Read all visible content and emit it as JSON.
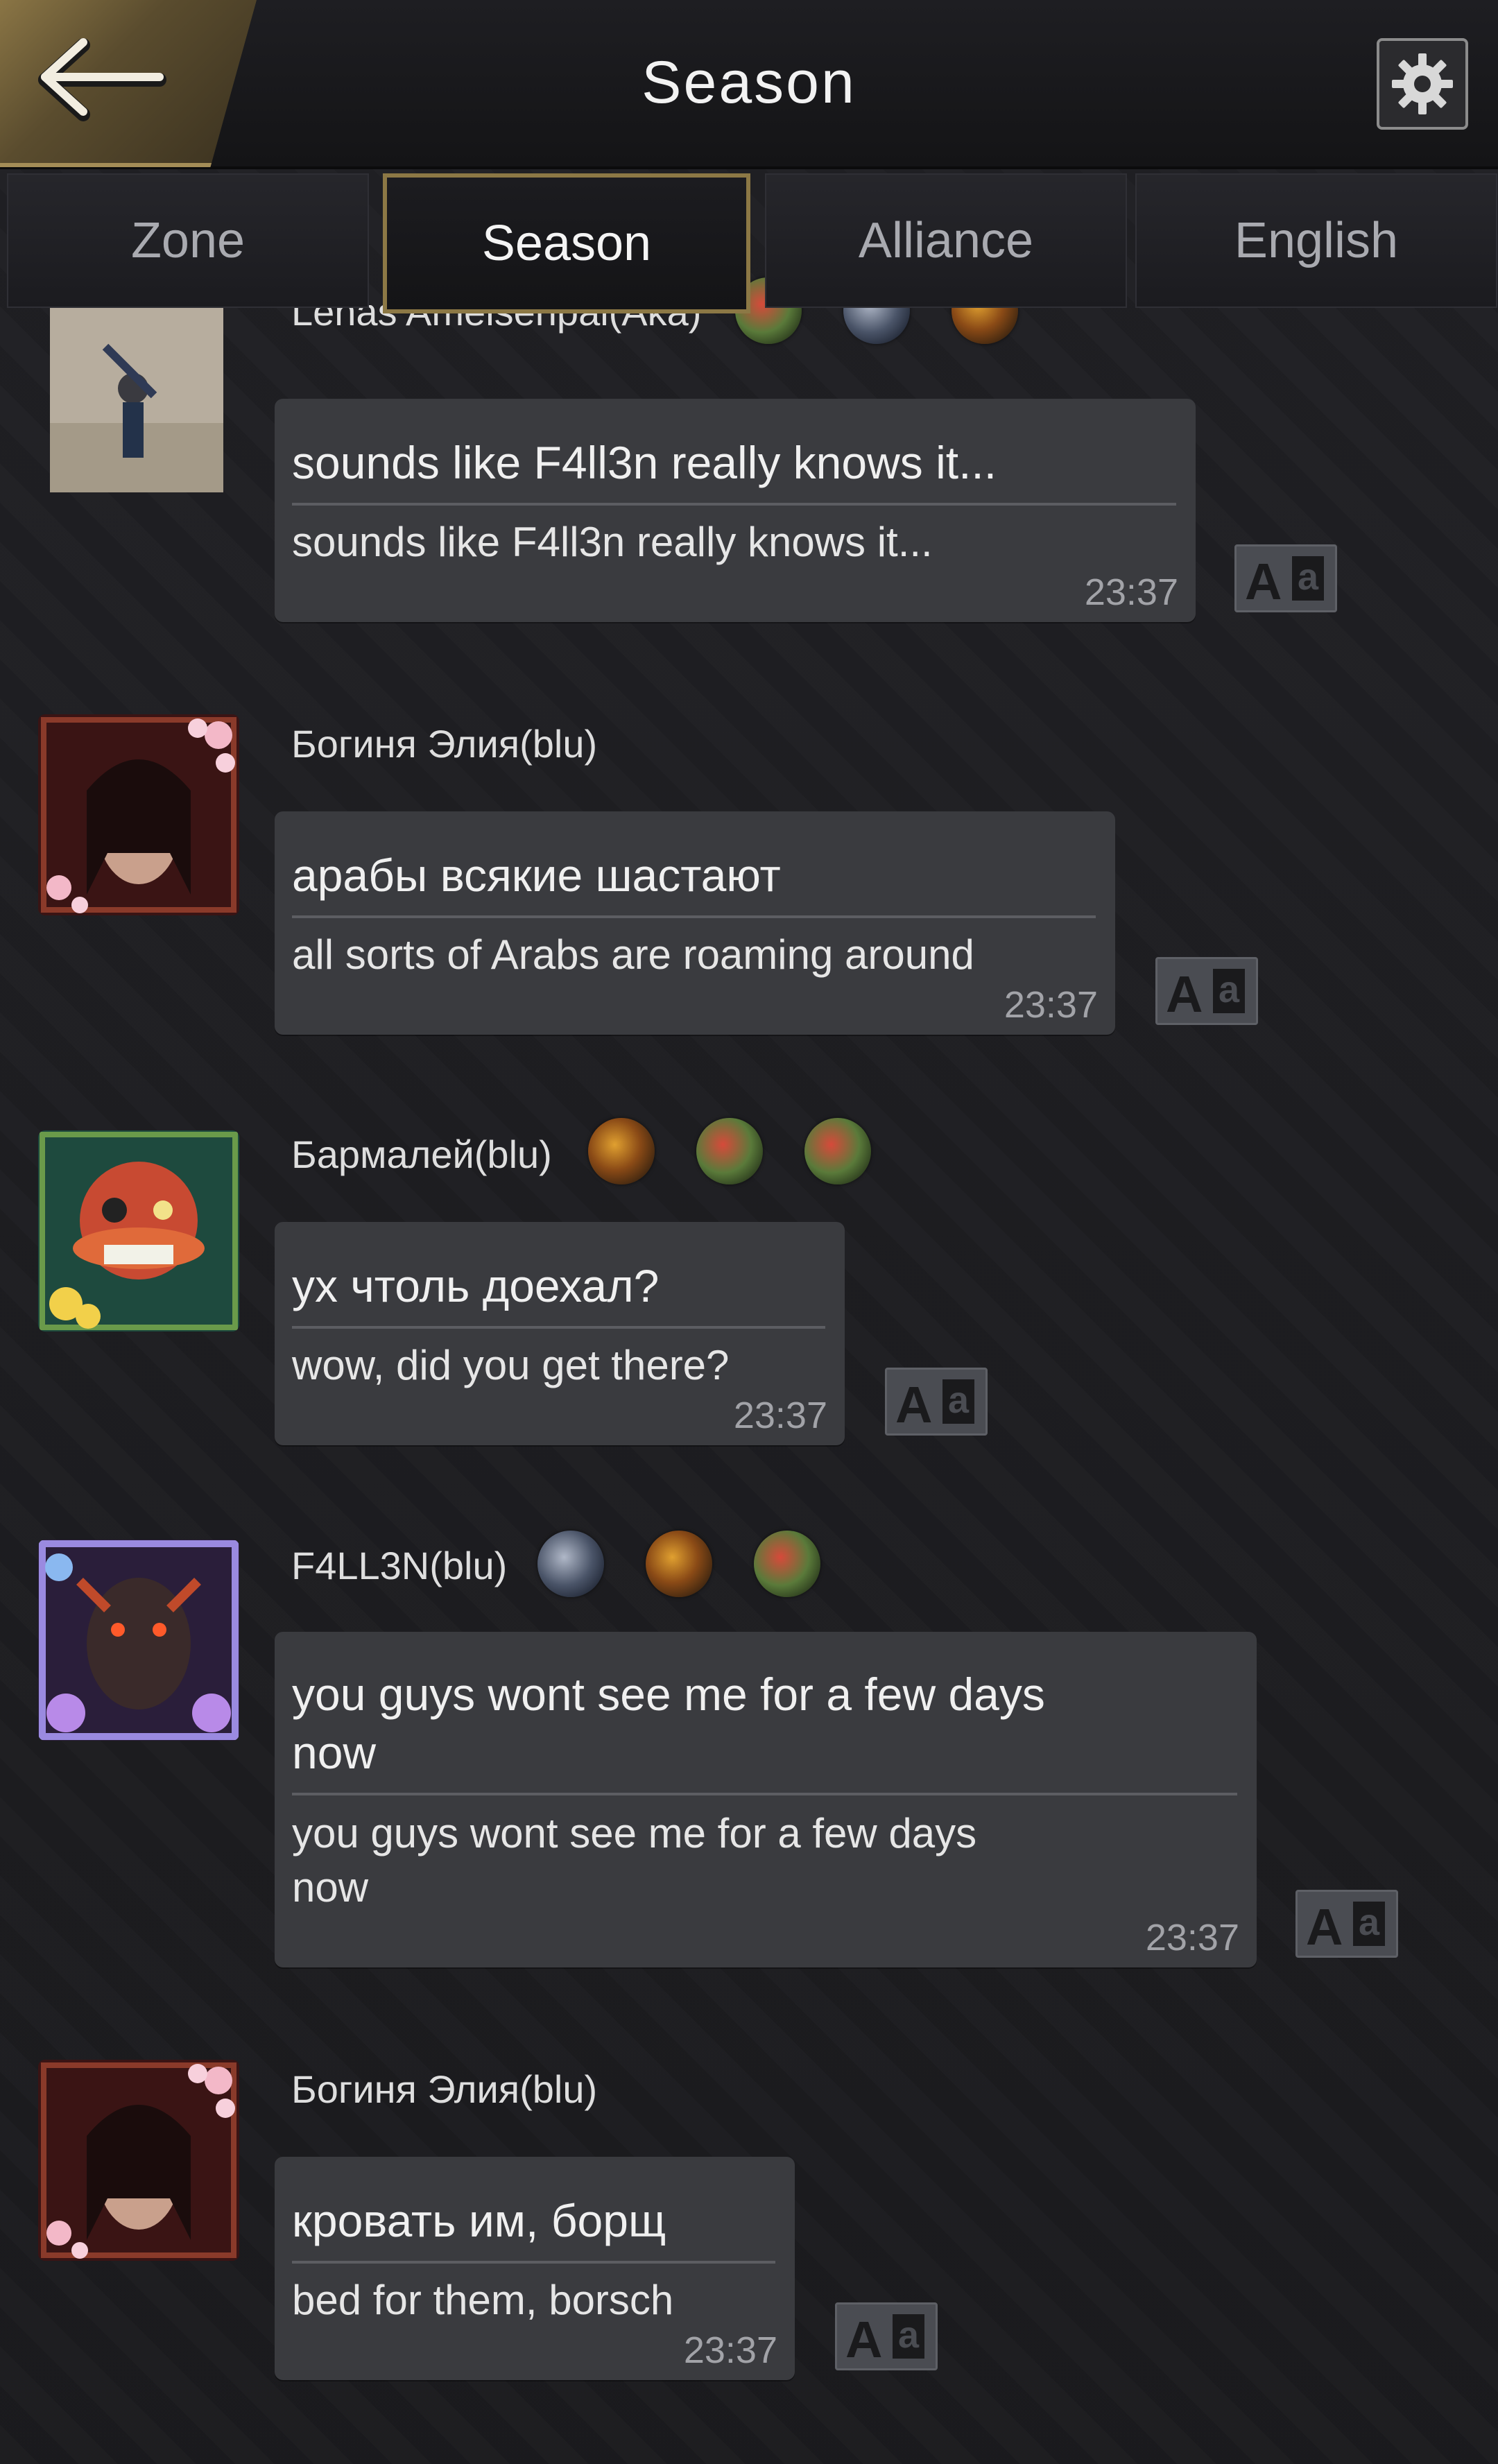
{
  "header": {
    "title": "Season"
  },
  "tabs": [
    {
      "label": "Zone"
    },
    {
      "label": "Season"
    },
    {
      "label": "Alliance"
    },
    {
      "label": "English"
    }
  ],
  "messages": [
    {
      "sender": "Lenas Ameisenpai(Aka)",
      "original": "sounds like F4ll3n really knows it...",
      "translation": "sounds like F4ll3n really knows it...",
      "time": "23:37"
    },
    {
      "sender": "Богиня Элия(blu)",
      "original": "арабы всякие шастают",
      "translation": "all sorts of Arabs are roaming around",
      "time": "23:37"
    },
    {
      "sender": "Бармалей(blu)",
      "original": "ух чтоль доехал?",
      "translation": "wow, did you get there?",
      "time": "23:37"
    },
    {
      "sender": "F4LL3N(blu)",
      "original_lines": [
        "you guys wont see me for a few days",
        "now"
      ],
      "translation_lines": [
        "you guys wont see me for a few days",
        "now"
      ],
      "time": "23:37"
    },
    {
      "sender": "Богиня Элия(blu)",
      "original": "кровать им, борщ",
      "translation": "bed for them, borsch",
      "time": "23:37"
    }
  ],
  "translate_button": {
    "big": "A",
    "small": "a"
  }
}
